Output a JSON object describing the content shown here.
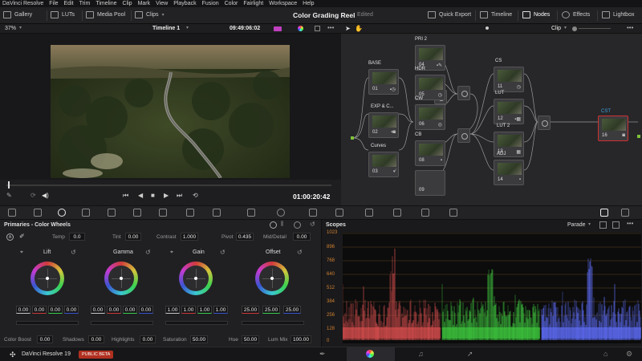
{
  "menu": [
    "DaVinci Resolve",
    "File",
    "Edit",
    "Trim",
    "Timeline",
    "Clip",
    "Mark",
    "View",
    "Playback",
    "Fusion",
    "Color",
    "Fairlight",
    "Workspace",
    "Help"
  ],
  "toolbar": {
    "gallery": "Gallery",
    "luts": "LUTs",
    "media_pool": "Media Pool",
    "clips": "Clips",
    "project_title": "Color Grading Reel",
    "project_status": "Edited",
    "quick_export": "Quick Export",
    "timeline": "Timeline",
    "nodes": "Nodes",
    "effects": "Effects",
    "lightbox": "Lightbox"
  },
  "viewer": {
    "zoom": "37%",
    "timeline_name": "Timeline 1",
    "timecode": "09:49:06:02",
    "playhead_timecode": "01:00:20:42"
  },
  "node_editor": {
    "mode": "Clip",
    "nodes": [
      {
        "label": "BASE",
        "num": "01"
      },
      {
        "label": "EXP & C...",
        "num": "02"
      },
      {
        "label": "Curves",
        "num": "03"
      },
      {
        "label": "PRI 2",
        "num": "04"
      },
      {
        "label": "HDR",
        "num": "05"
      },
      {
        "label": "CW",
        "num": "06"
      },
      {
        "label": "CB",
        "num": "08"
      },
      {
        "label": "",
        "num": "09"
      },
      {
        "label": "CS",
        "num": "11"
      },
      {
        "label": "LUT",
        "num": "12"
      },
      {
        "label": "LUT 2",
        "num": "13"
      },
      {
        "label": "ADJ",
        "num": "14"
      },
      {
        "label": "CST",
        "num": "16"
      }
    ]
  },
  "primaries": {
    "title": "Primaries - Color Wheels",
    "temp_label": "Temp",
    "temp": "0.0",
    "tint_label": "Tint",
    "tint": "0.00",
    "contrast_label": "Contrast",
    "contrast": "1.000",
    "pivot_label": "Pivot",
    "pivot": "0.435",
    "middetail_label": "Mid/Detail",
    "middetail": "0.00",
    "wheels": [
      {
        "name": "Lift",
        "values": [
          "0.00",
          "0.00",
          "0.00",
          "0.00"
        ]
      },
      {
        "name": "Gamma",
        "values": [
          "0.00",
          "0.00",
          "0.00",
          "0.00"
        ]
      },
      {
        "name": "Gain",
        "values": [
          "1.00",
          "1.00",
          "1.00",
          "1.00"
        ]
      },
      {
        "name": "Offset",
        "values": [
          "25.00",
          "25.00",
          "25.00"
        ]
      }
    ],
    "color_boost_label": "Color Boost",
    "color_boost": "0.00",
    "shadows_label": "Shadows",
    "shadows": "0.00",
    "highlights_label": "Highlights",
    "highlights": "0.00",
    "saturation_label": "Saturation",
    "saturation": "50.00",
    "hue_label": "Hue",
    "hue": "50.00",
    "lummix_label": "Lum Mix",
    "lummix": "100.00"
  },
  "scopes": {
    "title": "Scopes",
    "mode": "Parade",
    "y_labels": [
      "1023",
      "896",
      "768",
      "640",
      "512",
      "384",
      "256",
      "128",
      "0"
    ]
  },
  "bottom": {
    "app_name": "DaVinci Resolve 19",
    "badge": "PUBLIC BETA"
  },
  "colors": {
    "accent_orange": "#d08030",
    "node_green": "#7fc23a",
    "node_blue": "#3fa3e0",
    "beta_badge": "#c0392b"
  }
}
